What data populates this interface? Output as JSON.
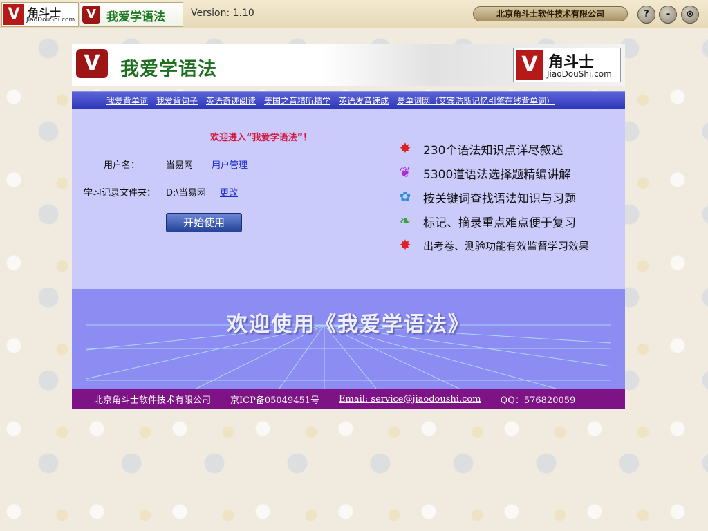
{
  "topbar": {
    "logo_brand": "角斗士",
    "logo_url": "JiaoDouShi.com",
    "logo_v": "V",
    "app_title": "我爱学语法",
    "version": "Version: 1.10",
    "company": "北京角斗士软件技术有限公司",
    "help_label": "?",
    "minimize_label": "–",
    "close_label": "⊗"
  },
  "banner": {
    "title": "我爱学语法",
    "logo_brand": "角斗士",
    "logo_url": "JiaoDouShi.com",
    "logo_v": "V"
  },
  "nav": {
    "items": [
      "我爱背单词",
      "我爱背句子",
      "英语奇迹阅读",
      "美国之音精听精学",
      "英语发音速成",
      "爱单词网（艾宾浩斯记忆引擎在线背单词）"
    ]
  },
  "login": {
    "welcome": "欢迎进入“我爱学语法”！",
    "username_label": "用户名：",
    "username_value": "当易网",
    "user_manage_link": "用户管理",
    "folder_label": "学习记录文件夹：",
    "folder_value": "D:\\当易网",
    "change_link": "更改",
    "start_button": "开始使用"
  },
  "features": [
    {
      "icon": "star-burst-icon",
      "text": "230个语法知识点详尽叙述",
      "color": "#e02020"
    },
    {
      "icon": "butterfly-icon",
      "text": "5300道语法选择题精编讲解",
      "color": "#b02ad6"
    },
    {
      "icon": "flower-icon",
      "text": "按关键词查找语法知识与习题",
      "color": "#2a8fd6"
    },
    {
      "icon": "leaf-icon",
      "text": "标记、摘录重点难点便于复习",
      "color": "#3aa23a"
    },
    {
      "icon": "star-burst-icon",
      "text": "出考卷、测验功能有效监督学习效果",
      "color": "#e02020"
    }
  ],
  "welcome_banner": {
    "text": "欢迎使用《我爱学语法》"
  },
  "footer": {
    "company": "北京角斗士软件技术有限公司",
    "icp": "京ICP备05049451号",
    "email": "Email: service@jiaodoushi.com",
    "qq": "QQ：576820059"
  },
  "colors": {
    "nav_bg": "#3a43c6",
    "login_bg": "#cbcbfb",
    "banner_bg": "#8d8cf2",
    "footer_bg": "#7d1384",
    "welcome_red": "#d6133a"
  }
}
